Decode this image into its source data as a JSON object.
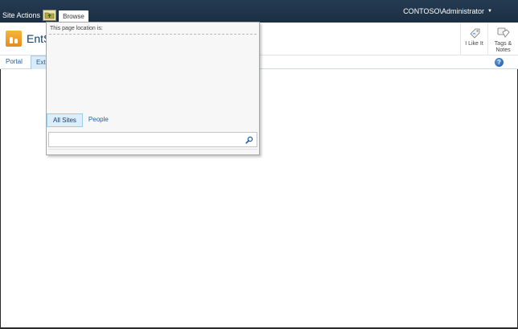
{
  "topbar": {
    "site_actions_label": "Site Actions",
    "browse_tab_label": "Browse",
    "user_label": "CONTOSO\\Administrator"
  },
  "title_area": {
    "site_title": "EntSe"
  },
  "ribbon": {
    "i_like_it_label": "I Like It",
    "tags_notes_label_line1": "Tags &",
    "tags_notes_label_line2": "Notes"
  },
  "topnav": {
    "items": [
      {
        "label": "Portal"
      },
      {
        "label": "Extr"
      }
    ],
    "help_glyph": "?"
  },
  "popup": {
    "heading": "This page location is:",
    "scopes": [
      {
        "label": "All Sites",
        "active": true
      },
      {
        "label": "People",
        "active": false
      }
    ],
    "search_value": "",
    "search_icon": "magnifier-icon"
  },
  "colors": {
    "topbar_bg": "#21374c",
    "accent_blue": "#1b5fa4",
    "logo_orange": "#f0a02a"
  }
}
